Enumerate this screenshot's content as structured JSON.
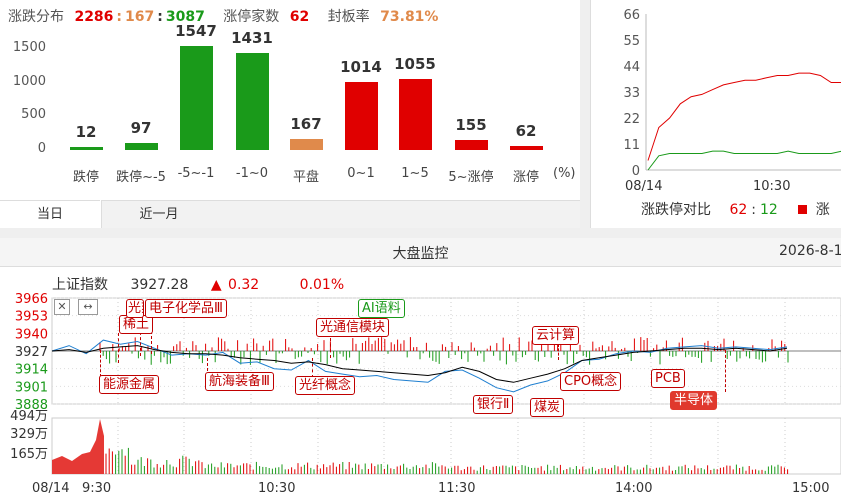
{
  "dist": {
    "label_dist": "涨跌分布",
    "up": "2286",
    "sep1": ":",
    "flat": "167",
    "sep2": ":",
    "down": "3087",
    "label_limit": "涨停家数",
    "limit_count": "62",
    "label_seal": "封板率",
    "seal_rate": "73.81%",
    "unit": "(%)",
    "tabs": [
      "当日",
      "近一月"
    ]
  },
  "chart_data": [
    {
      "type": "bar",
      "categories": [
        "跌停",
        "跌停~-5",
        "-5~-1",
        "-1~0",
        "平盘",
        "0~1",
        "1~5",
        "5~涨停",
        "涨停"
      ],
      "values": [
        12,
        97,
        1547,
        1431,
        167,
        1014,
        1055,
        155,
        62
      ],
      "colors": [
        "#1a9a1a",
        "#1a9a1a",
        "#1a9a1a",
        "#1a9a1a",
        "#e08a4b",
        "#e00000",
        "#e00000",
        "#e00000",
        "#e00000"
      ],
      "yticks": [
        "0",
        "500",
        "1000",
        "1500"
      ],
      "ylim": [
        0,
        1600
      ]
    },
    {
      "type": "line",
      "yticks": [
        "66",
        "55",
        "44",
        "33",
        "22",
        "11",
        "0"
      ],
      "xticks": [
        "08/14",
        "10:30"
      ],
      "series": [
        {
          "color": "#e00000",
          "values": [
            4,
            18,
            22,
            28,
            31,
            32,
            34,
            36,
            37,
            38,
            38,
            39,
            40,
            40,
            41,
            41,
            40,
            37,
            37
          ]
        },
        {
          "color": "#1a9a1a",
          "values": [
            0,
            6,
            7,
            7,
            7,
            7,
            8,
            8,
            7,
            7,
            7,
            7,
            7,
            8,
            7,
            7,
            7,
            7,
            8
          ]
        }
      ],
      "legend_label": "涨跌停对比",
      "legend_up": "62",
      "legend_sep": ":",
      "legend_down": "12",
      "legend_extra": "涨"
    },
    {
      "type": "line",
      "price_ticks": [
        "3966",
        "3953",
        "3940",
        "3927",
        "3914",
        "3901",
        "3888"
      ],
      "volume_ticks": [
        "494万",
        "329万",
        "165万"
      ],
      "time_ticks": [
        "08/14",
        "9:30",
        "10:30",
        "11:30",
        "14:00",
        "15:00"
      ],
      "series": [
        {
          "color": "#1f7fd0",
          "values": [
            3927,
            3931,
            3925,
            3935,
            3932,
            3934,
            3929,
            3924,
            3925,
            3924,
            3926,
            3918,
            3919,
            3914,
            3913,
            3920,
            3912,
            3910,
            3908,
            3909,
            3906,
            3905,
            3904,
            3912,
            3913,
            3907,
            3900,
            3897,
            3902,
            3905,
            3911,
            3920,
            3921,
            3925,
            3927,
            3926,
            3929,
            3930,
            3931,
            3929,
            3930,
            3929,
            3928,
            3930
          ]
        },
        {
          "color": "#000000",
          "values": [
            3927,
            3928,
            3926,
            3929,
            3930,
            3931,
            3928,
            3926,
            3925,
            3925,
            3924,
            3922,
            3921,
            3920,
            3918,
            3919,
            3917,
            3914,
            3913,
            3912,
            3911,
            3910,
            3909,
            3911,
            3915,
            3912,
            3906,
            3904,
            3907,
            3910,
            3914,
            3920,
            3922,
            3924,
            3926,
            3927,
            3928,
            3929,
            3929,
            3928,
            3929,
            3928,
            3927,
            3929
          ]
        }
      ]
    }
  ],
  "monitor": {
    "title": "大盘监控",
    "date": "2026-8-1",
    "index_name": "上证指数",
    "index_value": "3927.28",
    "index_arrow": "▲",
    "index_change": "0.32",
    "index_pct": "0.01%",
    "tags": [
      "稀土",
      "光刻",
      "电子化学品Ⅲ",
      "AI语料",
      "光通信模块",
      "云计算",
      "能源金属",
      "航海装备Ⅲ",
      "光纤概念",
      "银行Ⅱ",
      "煤炭",
      "CPO概念",
      "PCB",
      "半导体"
    ]
  }
}
